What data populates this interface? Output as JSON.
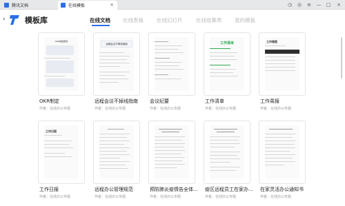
{
  "window": {
    "tabs": [
      {
        "label": "腾讯文档"
      },
      {
        "label": "在线模板"
      }
    ]
  },
  "app": {
    "title": "模板库"
  },
  "nav": [
    {
      "label": "在线文档"
    },
    {
      "label": "在线表格"
    },
    {
      "label": "在线幻灯片"
    },
    {
      "label": "在线收集表"
    },
    {
      "label": "我的模板"
    }
  ],
  "cards": [
    {
      "name": "OKR制定",
      "meta": "作者：在线办公专题",
      "preview_title": "OKR模板规划"
    },
    {
      "name": "远程会议不掉线指南",
      "meta": "作者：在线办公专题",
      "preview_title": "远程会议不掉线指南"
    },
    {
      "name": "会议纪要",
      "meta": "作者：在线办公专题",
      "preview_title": ""
    },
    {
      "name": "工作清单",
      "meta": "作者：在线办公专题",
      "preview_title": "工作清单"
    },
    {
      "name": "工作周报",
      "meta": "作者：在线办公专题",
      "preview_title": "工作周报"
    },
    {
      "name": "工作日报",
      "meta": "作者：在线办公专题",
      "preview_title": "工作日报"
    },
    {
      "name": "远程办公管理规范",
      "meta": "作者：在线办公专题",
      "preview_title": ""
    },
    {
      "name": "预防肺炎疫情告全体...",
      "meta": "作者：在线办公专题",
      "preview_title": ""
    },
    {
      "name": "疫区远程员工在家办...",
      "meta": "作者：在线办公专题",
      "preview_title": ""
    },
    {
      "name": "在家灵活办公通知书",
      "meta": "作者：在线办公专题",
      "preview_title": ""
    }
  ],
  "colors": {
    "accent": "#2b6fe8",
    "green": "#2fa84f",
    "dark_header": "#2f2f2f"
  }
}
